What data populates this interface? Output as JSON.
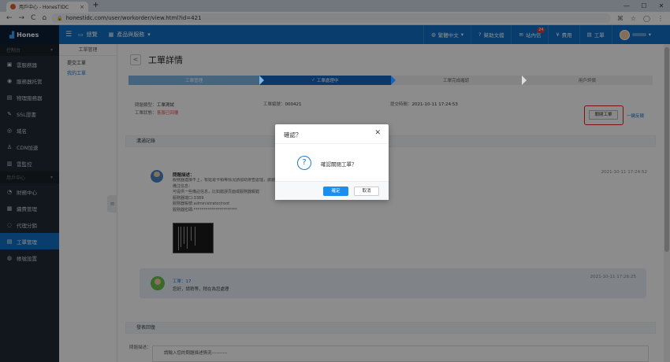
{
  "browser": {
    "tab_title": "用戶中心 - HonesTIDC",
    "tab_close": "×",
    "new_tab": "+",
    "back": "←",
    "forward": "→",
    "reload": "C",
    "home": "⌂",
    "url": "honestidc.com/user/workorder/view.html?id=421",
    "window_controls": [
      "—",
      "☐",
      "✕"
    ]
  },
  "header": {
    "logo_text": "Hones",
    "menu_icon": "☰",
    "nav": [
      {
        "icon": "monitor-icon",
        "label": "總覽"
      },
      {
        "icon": "grid-icon",
        "label": "產品與服務",
        "caret": "▾"
      }
    ],
    "right": [
      {
        "name": "language",
        "label": "繁體中文",
        "caret": "▾"
      },
      {
        "name": "help",
        "label": "幫助文檔"
      },
      {
        "name": "messages",
        "label": "站內信",
        "badge": "24"
      },
      {
        "name": "billing",
        "label": "費用"
      },
      {
        "name": "workorder",
        "label": "工單"
      }
    ]
  },
  "sidebar": {
    "group1": "控制台",
    "items1": [
      {
        "icon": "▣",
        "label": "雲服務器"
      },
      {
        "icon": "◉",
        "label": "服務器托管"
      },
      {
        "icon": "▤",
        "label": "物理服務器"
      },
      {
        "icon": "✎",
        "label": "SSL證書"
      },
      {
        "icon": "◎",
        "label": "域名"
      },
      {
        "icon": "♙",
        "label": "CDN加速"
      },
      {
        "icon": "▥",
        "label": "雲監控"
      }
    ],
    "group2": "用戶中心",
    "items2": [
      {
        "icon": "◔",
        "label": "財務中心"
      },
      {
        "icon": "▦",
        "label": "續費管理"
      },
      {
        "icon": "◌",
        "label": "代理分銷"
      },
      {
        "icon": "▤",
        "label": "工單管理",
        "active": true
      },
      {
        "icon": "◍",
        "label": "帳號設置"
      }
    ]
  },
  "subnav": {
    "title": "工單管理",
    "items": [
      "提交工單",
      "我的工單"
    ]
  },
  "page": {
    "title": "工單詳情",
    "back_icon": "<",
    "steps": [
      "工單管理",
      "工單處理中",
      "工單完成確認",
      "用戶評價"
    ],
    "step_check": "✓",
    "info": {
      "type_label": "問題類型：",
      "type_value": "工單測試",
      "status_label": "工單狀態：",
      "status_value": "客服已回覆",
      "id_label": "工單編號：",
      "id_value": "000421",
      "time_label": "提交時間：",
      "time_value": "2021-10-11 17:24:53"
    },
    "close_button": "關閉工單",
    "one_key": "一鍵反饋",
    "comm_header": "溝通記錄",
    "message1": {
      "title": "問題描述：",
      "lines": [
        "服務器連接不上，有延遲卡頓等情況請協助排查處理，謝謝！",
        "備注信息：",
        "可提供一些備註信息，比如錯誤頁面或服務器報錯",
        "服務器端口:3389",
        "服務器帳號:administrator/root",
        "服務器密碼:**********************"
      ],
      "time": "2021-10-11 17:24:52"
    },
    "reply": {
      "name": "工單：17",
      "text": "您好，請稍等，稍在為您處理",
      "time": "2021-10-11 17:26:25"
    },
    "form_header": "發表回復",
    "form_label": "問題描述：",
    "form_placeholder": "請輸入您的問題描述情況----------"
  },
  "modal": {
    "title": "確認？",
    "close": "✕",
    "icon": "?",
    "text": "確認關閉工單？",
    "ok": "確定",
    "cancel": "取消"
  }
}
